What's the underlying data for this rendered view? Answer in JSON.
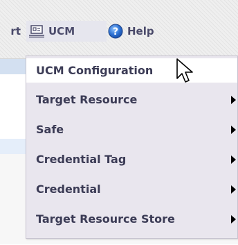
{
  "menubar": {
    "report_partial": "rt",
    "ucm_label": "UCM",
    "help_label": "Help"
  },
  "dropdown": {
    "items": [
      {
        "label": "UCM Configuration",
        "has_submenu": false,
        "highlighted": true
      },
      {
        "label": "Target Resource",
        "has_submenu": true,
        "highlighted": false
      },
      {
        "label": "Safe",
        "has_submenu": true,
        "highlighted": false
      },
      {
        "label": "Credential Tag",
        "has_submenu": true,
        "highlighted": false
      },
      {
        "label": "Credential",
        "has_submenu": true,
        "highlighted": false
      },
      {
        "label": "Target Resource Store",
        "has_submenu": true,
        "highlighted": false
      }
    ]
  },
  "icons": {
    "ucm": "monitor-icon",
    "help": "help-globe-icon",
    "cursor": "mouse-pointer-icon",
    "submenu": "submenu-arrow-icon"
  },
  "colors": {
    "menu_text": "#4a4a6a",
    "dropdown_bg": "#e9e6ee",
    "highlight_bg": "#ffffff",
    "help_icon_blue": "#2b6fd1"
  }
}
